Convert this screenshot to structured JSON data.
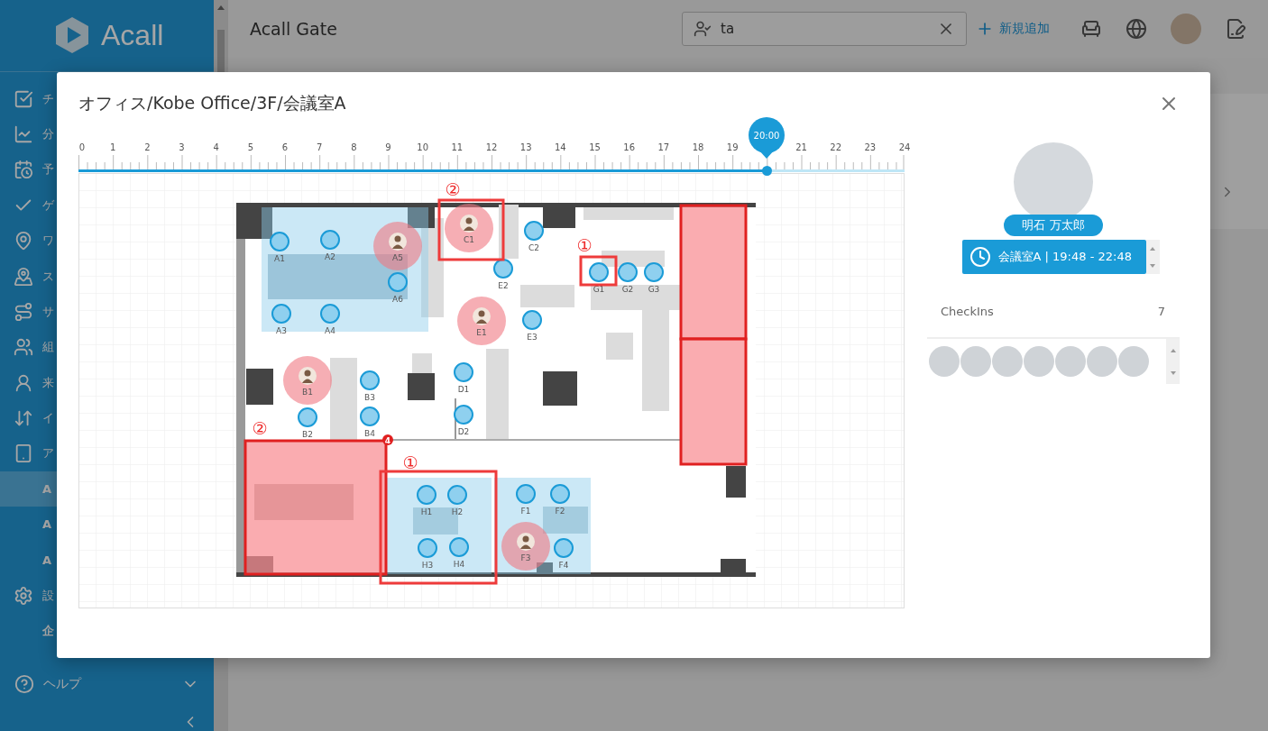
{
  "sidebar": {
    "logo": "Acall",
    "items": [
      {
        "label": "チ",
        "kind": "main",
        "selected": false
      },
      {
        "label": "分",
        "kind": "main",
        "selected": false
      },
      {
        "label": "予",
        "kind": "main",
        "selected": false
      },
      {
        "label": "ゲ",
        "kind": "main",
        "selected": false
      },
      {
        "label": "ワ",
        "kind": "main",
        "selected": false
      },
      {
        "label": "ス",
        "kind": "main",
        "selected": false
      },
      {
        "label": "サ",
        "kind": "main",
        "selected": false
      },
      {
        "label": "組",
        "kind": "main",
        "selected": false
      },
      {
        "label": "来",
        "kind": "main",
        "selected": false
      },
      {
        "label": "イ",
        "kind": "main",
        "selected": false
      },
      {
        "label": "ア",
        "kind": "main",
        "selected": false
      },
      {
        "label": "A",
        "kind": "sub",
        "selected": true
      },
      {
        "label": "A",
        "kind": "sub",
        "selected": false
      },
      {
        "label": "A",
        "kind": "sub",
        "selected": false
      },
      {
        "label": "設",
        "kind": "main",
        "selected": false
      },
      {
        "label": "企",
        "kind": "sub",
        "selected": false
      }
    ],
    "help": "ヘルプ"
  },
  "header": {
    "title": "Acall Gate",
    "search": {
      "value": "ta"
    },
    "add_button": "新規追加"
  },
  "modal": {
    "title": "オフィス/Kobe Office/3F/会議室A",
    "timeline": {
      "hours": [
        "0",
        "1",
        "2",
        "3",
        "4",
        "5",
        "6",
        "7",
        "8",
        "9",
        "10",
        "11",
        "12",
        "13",
        "14",
        "15",
        "16",
        "17",
        "18",
        "19",
        "21",
        "22",
        "23",
        "24"
      ],
      "time": "20:00",
      "level": 0.833
    },
    "floor_map": {
      "rooms": [
        {
          "booked": false
        },
        {
          "booked": false
        },
        {
          "booked": false
        },
        {
          "booked": true,
          "badge": "4"
        },
        {
          "booked": true
        },
        {
          "booked": true
        }
      ],
      "seats": [
        {
          "label": "A1",
          "occupied": false
        },
        {
          "label": "A2",
          "occupied": false
        },
        {
          "label": "A5",
          "occupied": true
        },
        {
          "label": "A6",
          "occupied": false
        },
        {
          "label": "A3",
          "occupied": false
        },
        {
          "label": "A4",
          "occupied": false
        },
        {
          "label": "C1",
          "occupied": true
        },
        {
          "label": "C2",
          "occupied": false
        },
        {
          "label": "E2",
          "occupied": false
        },
        {
          "label": "G1",
          "occupied": false
        },
        {
          "label": "G2",
          "occupied": false
        },
        {
          "label": "G3",
          "occupied": false
        },
        {
          "label": "E1",
          "occupied": true
        },
        {
          "label": "E3",
          "occupied": false
        },
        {
          "label": "B1",
          "occupied": true
        },
        {
          "label": "B3",
          "occupied": false
        },
        {
          "label": "D1",
          "occupied": false
        },
        {
          "label": "B2",
          "occupied": false
        },
        {
          "label": "B4",
          "occupied": false
        },
        {
          "label": "D2",
          "occupied": false
        },
        {
          "label": "H1",
          "occupied": false
        },
        {
          "label": "H2",
          "occupied": false
        },
        {
          "label": "F1",
          "occupied": false
        },
        {
          "label": "F2",
          "occupied": false
        },
        {
          "label": "H3",
          "occupied": false
        },
        {
          "label": "H4",
          "occupied": false
        },
        {
          "label": "F3",
          "occupied": true
        },
        {
          "label": "F4",
          "occupied": false
        }
      ],
      "annotations": [
        {
          "number": "②"
        },
        {
          "number": "①"
        },
        {
          "number": "②"
        },
        {
          "number": "①"
        }
      ]
    },
    "person": {
      "name": "明石 万太郎",
      "reservation": "会議室A | 19:48 - 22:48"
    },
    "checkins": {
      "label": "CheckIns",
      "count": "7",
      "avatars": [
        {
          "kind": "photo"
        },
        {
          "kind": "photo"
        },
        {
          "kind": "photo"
        },
        {
          "kind": "photo"
        },
        {
          "kind": "photo"
        },
        {
          "kind": "photo"
        },
        {
          "kind": "photo"
        }
      ]
    }
  }
}
